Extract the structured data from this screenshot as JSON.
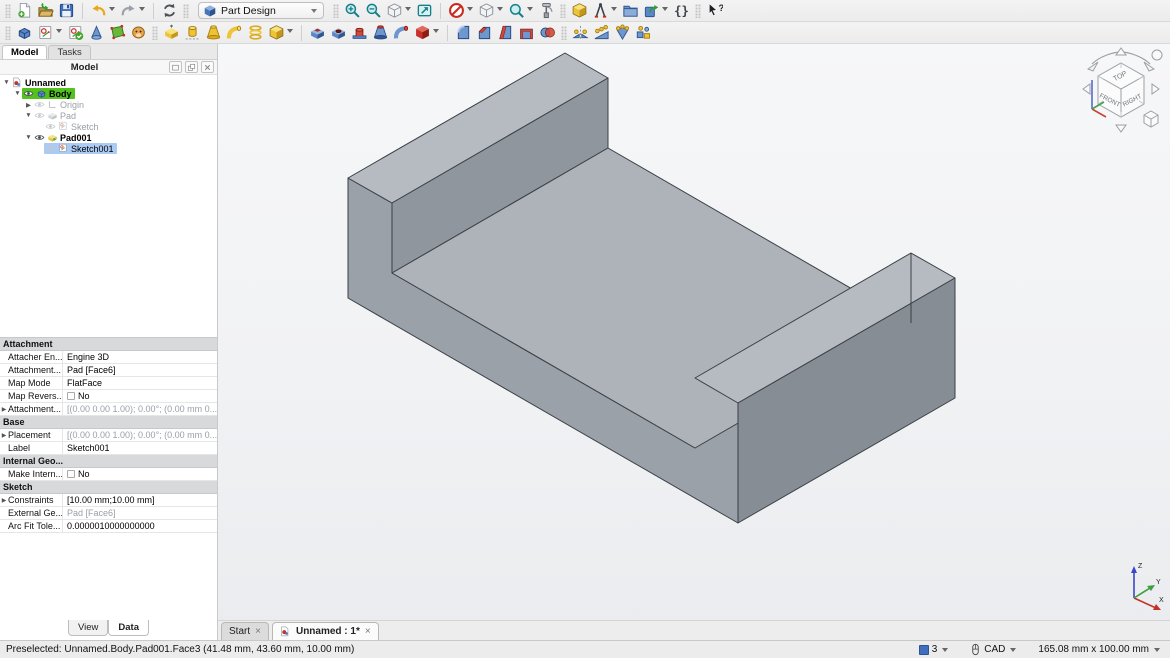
{
  "toolbar_main": {
    "workbench_selector": {
      "label": "Part Design",
      "icon": "workbench-cube"
    },
    "items": [
      {
        "kind": "grip"
      },
      {
        "name": "new-document",
        "icon": "new-file"
      },
      {
        "name": "open-document",
        "icon": "open-file"
      },
      {
        "name": "save-document",
        "icon": "save"
      },
      {
        "kind": "sep"
      },
      {
        "name": "undo",
        "icon": "undo",
        "dropdown": true
      },
      {
        "name": "redo",
        "icon": "redo",
        "dropdown": true
      },
      {
        "kind": "sep"
      },
      {
        "name": "refresh",
        "icon": "refresh"
      },
      {
        "kind": "grip"
      },
      {
        "kind": "combo"
      },
      {
        "kind": "grip"
      },
      {
        "name": "zoom-in",
        "icon": "zoom-in"
      },
      {
        "name": "zoom-out",
        "icon": "zoom-out"
      },
      {
        "name": "standard-views",
        "icon": "views-cube",
        "dropdown": true
      },
      {
        "name": "sync-view",
        "icon": "sync-view"
      },
      {
        "kind": "sep"
      },
      {
        "name": "draw-style",
        "icon": "draw-style",
        "dropdown": true
      },
      {
        "name": "view-isometric",
        "icon": "views-cube",
        "dropdown": true
      },
      {
        "name": "zoom-tools",
        "icon": "zoom-tools",
        "dropdown": true
      },
      {
        "name": "measure",
        "icon": "measure"
      },
      {
        "kind": "grip"
      },
      {
        "name": "create-part",
        "icon": "create-part"
      },
      {
        "name": "create-datum",
        "icon": "create-datum",
        "dropdown": true
      },
      {
        "name": "create-group",
        "icon": "create-group"
      },
      {
        "name": "create-link",
        "icon": "create-link",
        "dropdown": true
      },
      {
        "name": "expressions",
        "icon": "expressions"
      },
      {
        "kind": "grip"
      },
      {
        "name": "whats-this",
        "icon": "whats-this"
      }
    ]
  },
  "toolbar_partdesign": {
    "items": [
      {
        "kind": "grip"
      },
      {
        "name": "create-body",
        "icon": "create-body"
      },
      {
        "name": "create-sketch",
        "icon": "create-sketch",
        "dropdown": true
      },
      {
        "name": "edit-sketch",
        "icon": "edit-sketch"
      },
      {
        "name": "attach-sketch",
        "icon": "attach-sketch"
      },
      {
        "name": "create-shape-binder",
        "icon": "shape-binder"
      },
      {
        "name": "create-clone",
        "icon": "create-clone"
      },
      {
        "kind": "grip"
      },
      {
        "name": "pad",
        "icon": "pad"
      },
      {
        "name": "revolution",
        "icon": "revolution"
      },
      {
        "name": "additive-loft",
        "icon": "additive-loft"
      },
      {
        "name": "additive-pipe",
        "icon": "additive-pipe"
      },
      {
        "name": "additive-helix",
        "icon": "additive-helix"
      },
      {
        "name": "additive-primitive",
        "icon": "additive-primitive",
        "dropdown": true
      },
      {
        "kind": "sep"
      },
      {
        "name": "pocket",
        "icon": "pocket"
      },
      {
        "name": "hole",
        "icon": "hole"
      },
      {
        "name": "groove",
        "icon": "groove"
      },
      {
        "name": "subtractive-loft",
        "icon": "subtractive-loft"
      },
      {
        "name": "subtractive-pipe",
        "icon": "subtractive-pipe"
      },
      {
        "name": "subtractive-primitive",
        "icon": "subtractive-primitive",
        "dropdown": true
      },
      {
        "kind": "sep"
      },
      {
        "name": "fillet",
        "icon": "fillet"
      },
      {
        "name": "chamfer",
        "icon": "chamfer"
      },
      {
        "name": "draft",
        "icon": "draft"
      },
      {
        "name": "thickness",
        "icon": "thickness"
      },
      {
        "name": "boolean",
        "icon": "boolean"
      },
      {
        "kind": "grip"
      },
      {
        "name": "mirrored",
        "icon": "mirrored"
      },
      {
        "name": "linear-pattern",
        "icon": "linear-pattern"
      },
      {
        "name": "polar-pattern",
        "icon": "polar-pattern"
      },
      {
        "name": "multitransform",
        "icon": "multitransform"
      }
    ]
  },
  "left_dock": {
    "tabs": [
      {
        "label": "Model",
        "active": true
      },
      {
        "label": "Tasks",
        "active": false
      }
    ],
    "panel_title": "Model",
    "tree": [
      {
        "label": "Unnamed",
        "icon": "doc",
        "level": 0,
        "expander": "down",
        "bold": true
      },
      {
        "label": "Body",
        "icon": "body",
        "level": 1,
        "expander": "down",
        "eye": "visible",
        "highlight": "green",
        "bold": true
      },
      {
        "label": "Origin",
        "icon": "origin",
        "level": 2,
        "expander": "right",
        "eye": "hidden",
        "dim": true
      },
      {
        "label": "Pad",
        "icon": "pad-gray",
        "level": 2,
        "expander": "down",
        "eye": "hidden",
        "dim": true
      },
      {
        "label": "Sketch",
        "icon": "sketch",
        "level": 3,
        "eye": "hidden",
        "dim": true
      },
      {
        "label": "Pad001",
        "icon": "pad-tip",
        "level": 2,
        "expander": "down",
        "eye": "visible",
        "bold": true
      },
      {
        "label": "Sketch001",
        "icon": "sketch",
        "level": 3,
        "eye": "hidden",
        "highlight": "blue"
      }
    ],
    "properties": [
      {
        "type": "section",
        "label": "Attachment"
      },
      {
        "label": "Attacher En...",
        "value": "Engine 3D"
      },
      {
        "label": "Attachment...",
        "value": "Pad [Face6]"
      },
      {
        "label": "Map Mode",
        "value": "FlatFace"
      },
      {
        "label": "Map Revers...",
        "value": "No",
        "checkbox": true
      },
      {
        "label": "Attachment...",
        "value": "[(0.00 0.00 1.00); 0.00°; (0.00 mm  0...",
        "expand": true,
        "dim": true
      },
      {
        "type": "section",
        "label": "Base"
      },
      {
        "label": "Placement",
        "value": "[(0.00 0.00 1.00); 0.00°; (0.00 mm  0...",
        "expand": true,
        "dim": true
      },
      {
        "label": "Label",
        "value": "Sketch001"
      },
      {
        "type": "section",
        "label": "Internal Geo..."
      },
      {
        "label": "Make Intern...",
        "value": "No",
        "checkbox": true
      },
      {
        "type": "section",
        "label": "Sketch"
      },
      {
        "label": "Constraints",
        "value": "[10.00 mm;10.00 mm]",
        "expand": true
      },
      {
        "label": "External Ge...",
        "value": "Pad [Face6]",
        "dim": true
      },
      {
        "label": "Arc Fit Tole...",
        "value": "0.0000010000000000"
      }
    ],
    "footer_tabs": [
      {
        "label": "View",
        "active": false
      },
      {
        "label": "Data",
        "active": true
      }
    ]
  },
  "viewport": {
    "mdi_tabs": [
      {
        "label": "Start",
        "close": "×",
        "active": false
      },
      {
        "label": "Unnamed : 1*",
        "close": "×",
        "active": true,
        "icon": "freecad-doc"
      }
    ],
    "nav_cube": {
      "top": "TOP",
      "front": "FRONT",
      "right": "RIGHT"
    },
    "axis_triad": {
      "x": "X",
      "y": "Y",
      "z": "Z"
    },
    "part": {
      "colors": {
        "top": "#b6bbc1",
        "base_top": "#aeb3b9",
        "side": "#9ba1a8",
        "inner": "#90969d",
        "dark": "#878d94",
        "edge": "#3b4046"
      }
    }
  },
  "status_bar": {
    "message": "Preselected: Unnamed.Body.Pad001.Face3 (41.48 mm, 43.60 mm, 10.00 mm)",
    "render_count": "3",
    "nav_style": "CAD",
    "view_dimensions": "165.08 mm x 100.00 mm"
  }
}
